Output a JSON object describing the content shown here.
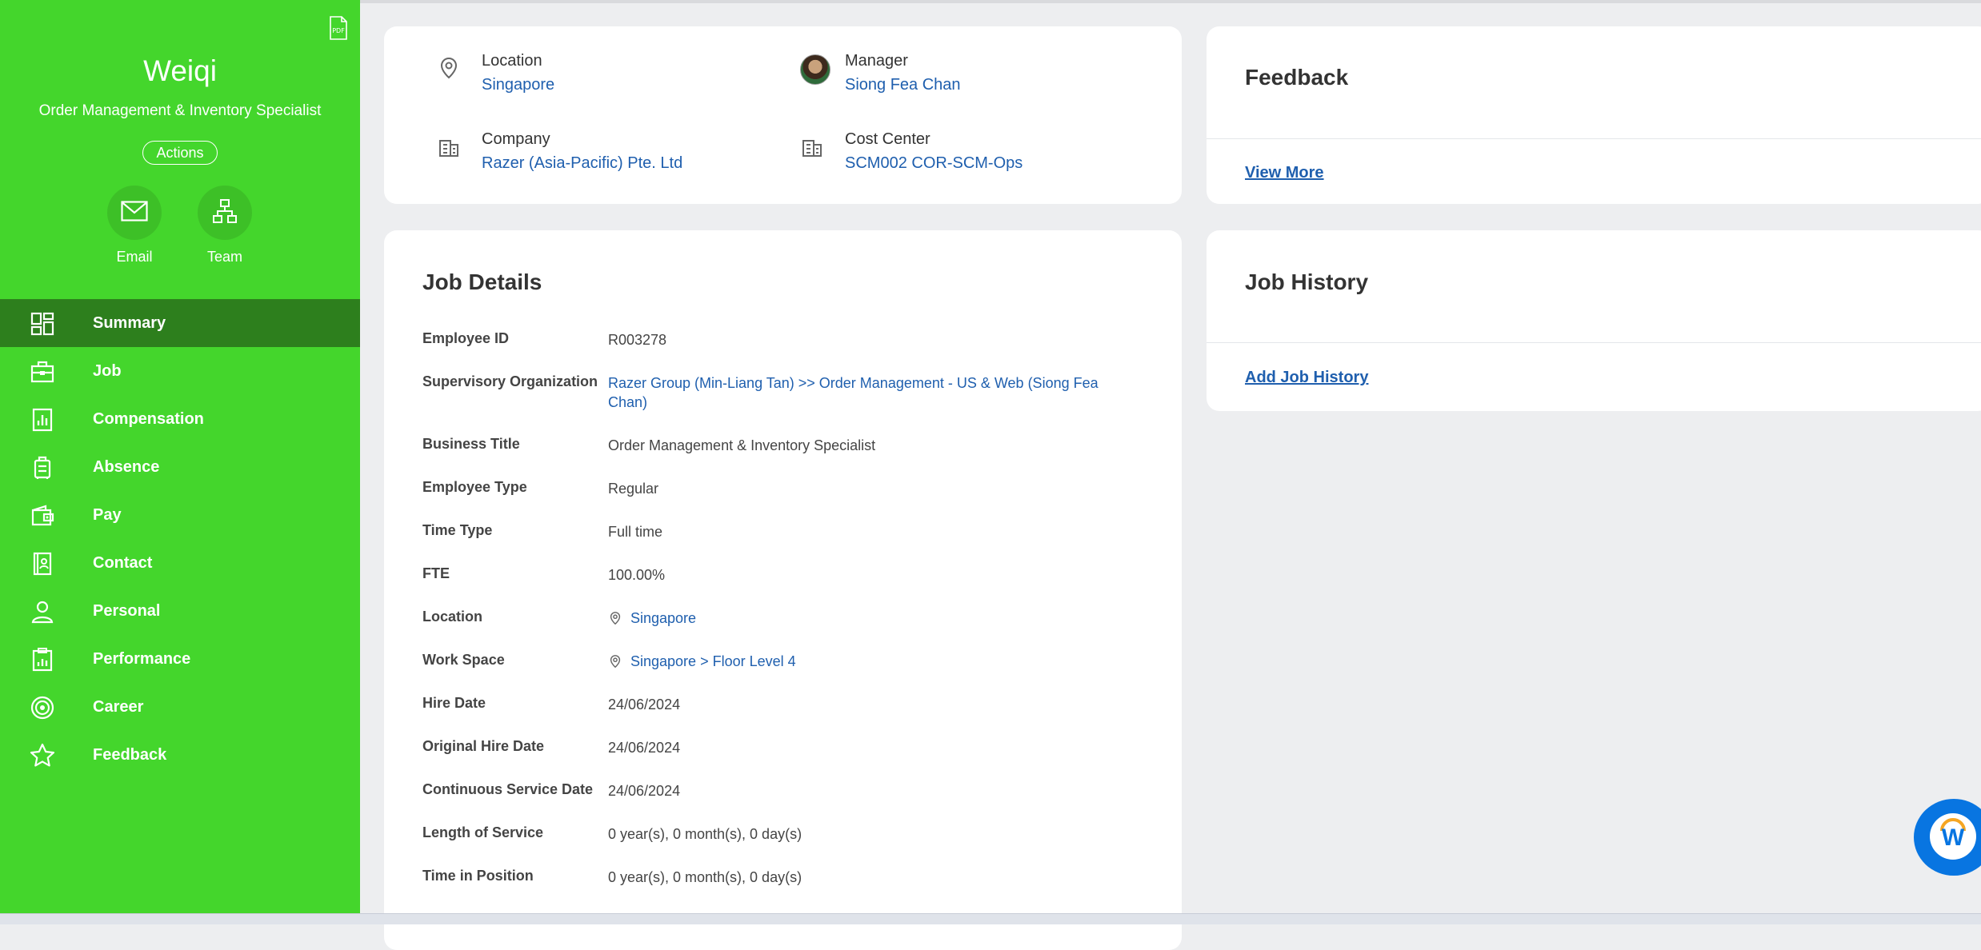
{
  "profile": {
    "name": "Weiqi",
    "title": "Order Management & Inventory Specialist",
    "actions_label": "Actions",
    "email_label": "Email",
    "team_label": "Team"
  },
  "nav": [
    {
      "label": "Summary",
      "icon": "dashboard-icon",
      "active": true
    },
    {
      "label": "Job",
      "icon": "briefcase-icon"
    },
    {
      "label": "Compensation",
      "icon": "bar-chart-icon"
    },
    {
      "label": "Absence",
      "icon": "luggage-icon"
    },
    {
      "label": "Pay",
      "icon": "wallet-icon"
    },
    {
      "label": "Contact",
      "icon": "contact-book-icon"
    },
    {
      "label": "Personal",
      "icon": "person-icon"
    },
    {
      "label": "Performance",
      "icon": "clipboard-chart-icon"
    },
    {
      "label": "Career",
      "icon": "target-icon"
    },
    {
      "label": "Feedback",
      "icon": "star-icon"
    }
  ],
  "info": {
    "location_label": "Location",
    "location_value": "Singapore",
    "manager_label": "Manager",
    "manager_value": "Siong Fea Chan",
    "company_label": "Company",
    "company_value": "Razer (Asia-Pacific) Pte. Ltd",
    "cost_center_label": "Cost Center",
    "cost_center_value": "SCM002 COR-SCM-Ops"
  },
  "feedback": {
    "heading": "Feedback",
    "link": "View More"
  },
  "job_history": {
    "heading": "Job History",
    "link": "Add Job History"
  },
  "job_details": {
    "heading": "Job Details",
    "rows": [
      {
        "label": "Employee ID",
        "value": "R003278"
      },
      {
        "label": "Supervisory Organization",
        "value": "Razer Group (Min-Liang Tan) >> Order Management - US & Web (Siong Fea Chan)"
      },
      {
        "label": "Business Title",
        "value": "Order Management & Inventory Specialist"
      },
      {
        "label": "Employee Type",
        "value": "Regular"
      },
      {
        "label": "Time Type",
        "value": "Full time"
      },
      {
        "label": "FTE",
        "value": "100.00%"
      },
      {
        "label": "Location",
        "value": "Singapore"
      },
      {
        "label": "Work Space",
        "value": "Singapore > Floor Level 4"
      },
      {
        "label": "Hire Date",
        "value": "24/06/2024"
      },
      {
        "label": "Original Hire Date",
        "value": "24/06/2024"
      },
      {
        "label": "Continuous Service Date",
        "value": "24/06/2024"
      },
      {
        "label": "Length of Service",
        "value": "0 year(s), 0 month(s), 0 day(s)"
      },
      {
        "label": "Time in Position",
        "value": "0 year(s), 0 month(s), 0 day(s)"
      }
    ]
  },
  "assistant": {
    "letter": "W"
  },
  "colors": {
    "sidebar_bg": "#44d62c",
    "sidebar_active": "#2d7f1d",
    "link": "#1f5fae",
    "page_bg": "#edeef0"
  }
}
